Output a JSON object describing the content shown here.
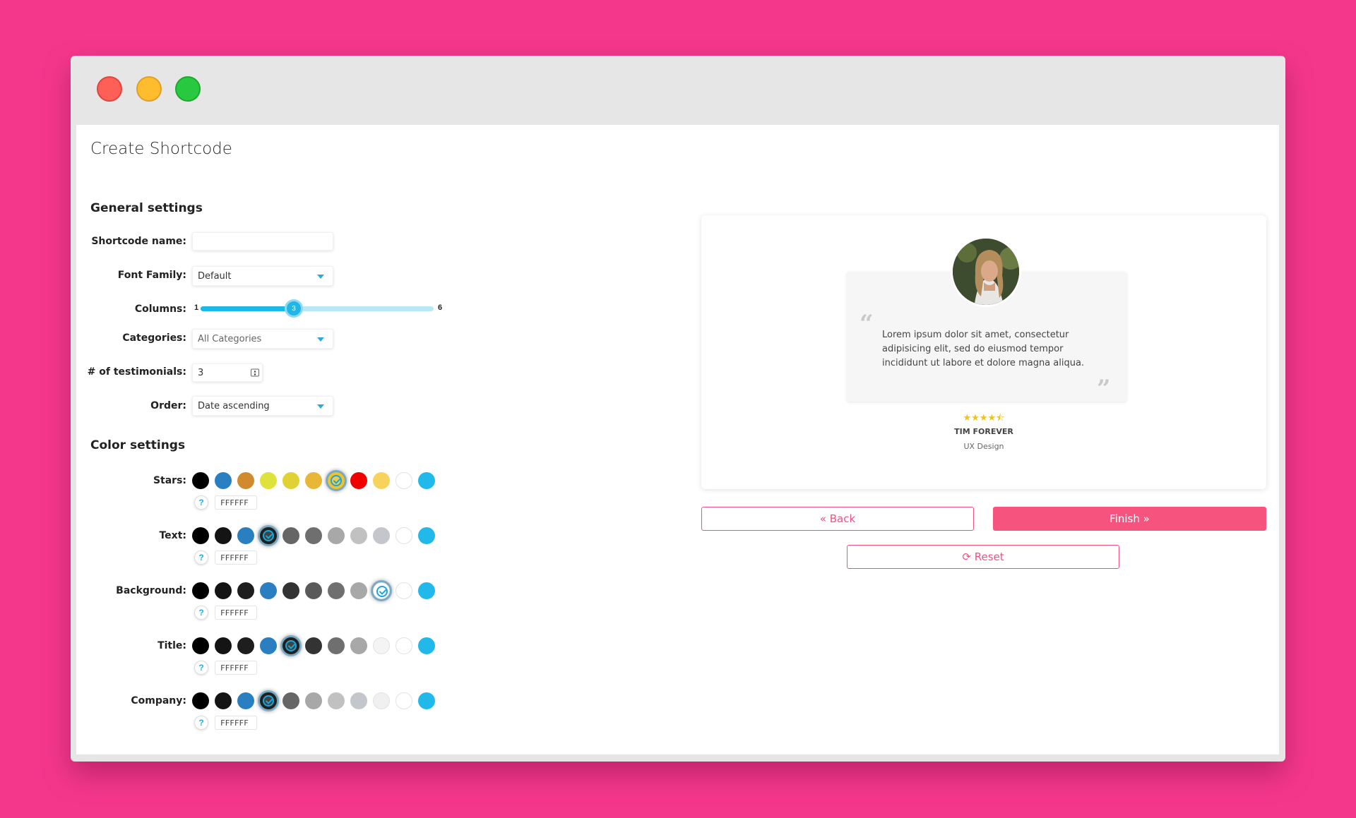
{
  "window": {
    "controls": [
      "close",
      "minimize",
      "maximize"
    ]
  },
  "page": {
    "title": "Create Shortcode"
  },
  "general": {
    "title": "General settings",
    "shortcode_name_label": "Shortcode name:",
    "shortcode_name_value": "",
    "font_family_label": "Font Family:",
    "font_family_value": "Default",
    "columns_label": "Columns:",
    "columns_min": "1",
    "columns_max": "6",
    "columns_value": "3",
    "columns_fraction": 0.4,
    "categories_label": "Categories:",
    "categories_value": "All Categories",
    "testimonials_label": "# of testimonials:",
    "testimonials_value": "3",
    "order_label": "Order:",
    "order_value": "Date ascending"
  },
  "colors": {
    "title": "Color settings",
    "help_label": "?",
    "rows": [
      {
        "label": "Stars:",
        "hex": "FFFFFF",
        "selected": 6,
        "swatches": [
          "#000000",
          "#2a7fc1",
          "#d08b2e",
          "#dfe23a",
          "#e0d135",
          "#e8b738",
          "#f0c22e",
          "#f10000",
          "#f7d35e",
          "#ffffff",
          "#21b8ea"
        ]
      },
      {
        "label": "Text:",
        "hex": "FFFFFF",
        "selected": 3,
        "swatches": [
          "#000000",
          "#141414",
          "#2a7fc1",
          "#202020",
          "#666666",
          "#6f6f6f",
          "#a8a8a8",
          "#c1c1c1",
          "#c3c7cc",
          "#ffffff",
          "#21b8ea"
        ]
      },
      {
        "label": "Background:",
        "hex": "FFFFFF",
        "selected": 8,
        "swatches": [
          "#000000",
          "#141414",
          "#1e1e1e",
          "#2a7fc1",
          "#333333",
          "#5a5a5a",
          "#6f6f6f",
          "#a8a8a8",
          "#ffffff",
          "#ffffff",
          "#21b8ea"
        ]
      },
      {
        "label": "Title:",
        "hex": "FFFFFF",
        "selected": 4,
        "swatches": [
          "#000000",
          "#141414",
          "#1e1e1e",
          "#2a7fc1",
          "#202020",
          "#333333",
          "#6f6f6f",
          "#a8a8a8",
          "#f4f4f4",
          "#ffffff",
          "#21b8ea"
        ]
      },
      {
        "label": "Company:",
        "hex": "FFFFFF",
        "selected": 3,
        "swatches": [
          "#000000",
          "#141414",
          "#2a7fc1",
          "#202020",
          "#666666",
          "#a8a8a8",
          "#c1c1c1",
          "#c3c7cc",
          "#f0f0f0",
          "#ffffff",
          "#21b8ea"
        ]
      }
    ]
  },
  "preview": {
    "quote": "Lorem ipsum dolor sit amet, consectetur adipisicing elit, sed do eiusmod tempor incididunt ut labore et dolore magna aliqua.",
    "open_quote": "“",
    "close_quote": "”",
    "stars": "★★★★⯪",
    "rating": 4.5,
    "name": "TIM FOREVER",
    "company": "UX Design"
  },
  "actions": {
    "back_label": "« Back",
    "finish_label": "Finish »",
    "reset_label": "⟳ Reset"
  },
  "theme": {
    "accent": "#f6547f",
    "slider": "#1eb8e8",
    "background": "#f5378c"
  }
}
